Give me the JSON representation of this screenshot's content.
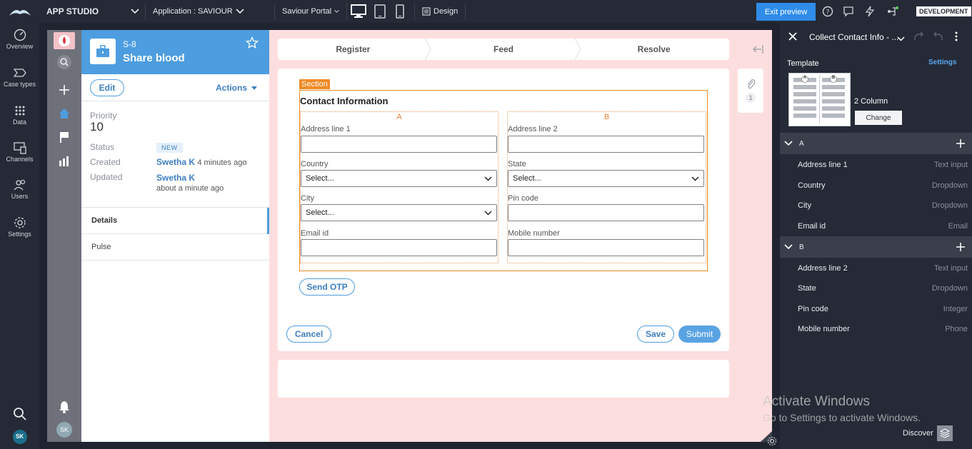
{
  "topbar": {
    "app_name": "APP STUDIO",
    "application": "Application : SAVIOUR",
    "portal": "Saviour Portal",
    "design": "Design",
    "exit_preview": "Exit preview",
    "environment": "DEVELOPMENT"
  },
  "studio_nav": [
    "Overview",
    "Case types",
    "Data",
    "Channels",
    "Users",
    "Settings"
  ],
  "user_initials": "SK",
  "case": {
    "id": "S-8",
    "title": "Share blood",
    "edit_label": "Edit",
    "actions_label": "Actions",
    "priority_label": "Priority",
    "priority_value": "10",
    "status_label": "Status",
    "status_value": "NEW",
    "created_label": "Created",
    "created_by": "Swetha K",
    "created_when": "4 minutes ago",
    "updated_label": "Updated",
    "updated_by": "Swetha K",
    "updated_when": "about a minute ago",
    "tabs": [
      "Details",
      "Pulse"
    ]
  },
  "stages": [
    "Register",
    "Feed",
    "Resolve"
  ],
  "form": {
    "section_tag": "Section",
    "section_title": "Contact Information",
    "column_a": "A",
    "column_b": "B",
    "address1_label": "Address line 1",
    "country_label": "Country",
    "country_value": "Select...",
    "city_label": "City",
    "city_value": "Select...",
    "email_label": "Email id",
    "address2_label": "Address line 2",
    "state_label": "State",
    "state_value": "Select...",
    "pincode_label": "Pin code",
    "mobile_label": "Mobile number",
    "send_otp": "Send OTP",
    "cancel": "Cancel",
    "save": "Save",
    "submit": "Submit"
  },
  "attachments_count": "1",
  "panel": {
    "title": "Collect Contact Info - ...",
    "template_label": "Template",
    "settings_label": "Settings",
    "template_name": "2 Column",
    "change_label": "Change",
    "group_a": "A",
    "group_b": "B",
    "fields_a": [
      {
        "name": "Address line 1",
        "type": "Text input"
      },
      {
        "name": "Country",
        "type": "Dropdown"
      },
      {
        "name": "City",
        "type": "Dropdown"
      },
      {
        "name": "Email id",
        "type": "Email"
      }
    ],
    "fields_b": [
      {
        "name": "Address line 2",
        "type": "Text input"
      },
      {
        "name": "State",
        "type": "Dropdown"
      },
      {
        "name": "Pin code",
        "type": "Integer"
      },
      {
        "name": "Mobile number",
        "type": "Phone"
      }
    ]
  },
  "watermark": {
    "line1": "Activate Windows",
    "line2": "Go to Settings to activate Windows."
  },
  "discover_label": "Discover",
  "colors": {
    "accent": "#4d9de0",
    "section_orange": "#f08a24",
    "workarea_bg": "#fddede",
    "chrome": "#252a36"
  }
}
